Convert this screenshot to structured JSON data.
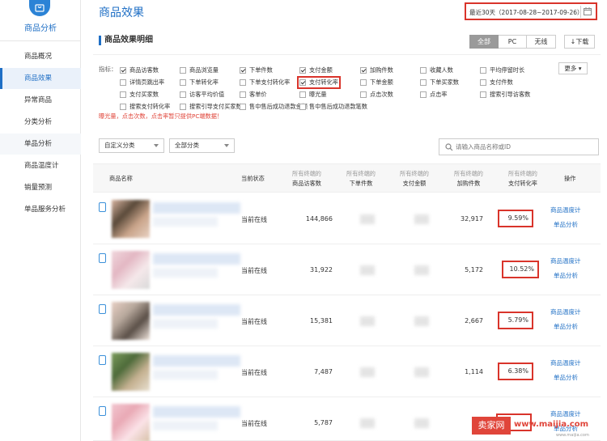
{
  "sidebar": {
    "title": "商品分析",
    "items": [
      {
        "label": "商品概况"
      },
      {
        "label": "商品效果"
      },
      {
        "label": "异常商品"
      },
      {
        "label": "分类分析"
      },
      {
        "label": "单品分析"
      },
      {
        "label": "商品温度计"
      },
      {
        "label": "销量预测"
      },
      {
        "label": "单品服务分析"
      }
    ]
  },
  "header": {
    "title": "商品效果",
    "date_range": "最近30天（2017-08-28~2017-09-26）"
  },
  "panel": {
    "title": "商品效果明细",
    "tabs": [
      {
        "label": "全部"
      },
      {
        "label": "PC"
      },
      {
        "label": "无线"
      }
    ],
    "download_label": "↓下载",
    "metrics_label": "指标：",
    "more_label": "更多",
    "metrics": [
      {
        "label": "商品访客数",
        "checked": true
      },
      {
        "label": "商品浏览量",
        "checked": false
      },
      {
        "label": "下单件数",
        "checked": true
      },
      {
        "label": "支付金额",
        "checked": true
      },
      {
        "label": "加购件数",
        "checked": true
      },
      {
        "label": "收藏人数",
        "checked": false
      },
      {
        "label": "平均停留时长",
        "checked": false
      },
      {
        "label": "详情页跳出率",
        "checked": false
      },
      {
        "label": "下单转化率",
        "checked": false
      },
      {
        "label": "下单支付转化率",
        "checked": false
      },
      {
        "label": "支付转化率",
        "checked": true
      },
      {
        "label": "下单金额",
        "checked": false
      },
      {
        "label": "下单买家数",
        "checked": false
      },
      {
        "label": "支付件数",
        "checked": false
      },
      {
        "label": "支付买家数",
        "checked": false
      },
      {
        "label": "访客平均价值",
        "checked": false
      },
      {
        "label": "客单价",
        "checked": false
      },
      {
        "label": "曝光量",
        "checked": false
      },
      {
        "label": "点击次数",
        "checked": false
      },
      {
        "label": "点击率",
        "checked": false
      },
      {
        "label": "搜索引导访客数",
        "checked": false
      },
      {
        "label": "搜索支付转化率",
        "checked": false
      },
      {
        "label": "搜索引导支付买家数",
        "checked": false
      },
      {
        "label": "售中售后成功退款金额",
        "checked": false
      },
      {
        "label": "售中售后成功退款笔数",
        "checked": false
      }
    ],
    "note": "曝光量，点击次数，点击率暂只提供PC端数据！"
  },
  "filters": {
    "category1": "自定义分类",
    "category2": "全部分类",
    "search_placeholder": "请输入商品名称或ID"
  },
  "table": {
    "headers": {
      "name": "商品名称",
      "status": "当前状态",
      "visitors_sub": "所有终端的",
      "visitors": "商品访客数",
      "orders_sub": "所有终端的",
      "orders": "下单件数",
      "pay_sub": "所有终端的",
      "pay": "支付金额",
      "cart_sub": "所有终端的",
      "cart": "加购件数",
      "conv_sub": "所有终端的",
      "conv": "支付转化率",
      "ops": "操作"
    },
    "rows": [
      {
        "status": "当前在线",
        "visitors": "144,866",
        "cart": "32,917",
        "conv": "9.59%",
        "link1": "商品温度计",
        "link2": "单品分析"
      },
      {
        "status": "当前在线",
        "visitors": "31,922",
        "cart": "5,172",
        "conv": "10.52%",
        "link1": "商品温度计",
        "link2": "单品分析"
      },
      {
        "status": "当前在线",
        "visitors": "15,381",
        "cart": "2,667",
        "conv": "5.79%",
        "link1": "商品温度计",
        "link2": "单品分析"
      },
      {
        "status": "当前在线",
        "visitors": "7,487",
        "cart": "1,114",
        "conv": "6.38%",
        "link1": "商品温度计",
        "link2": "单品分析"
      },
      {
        "status": "当前在线",
        "visitors": "5,787",
        "cart": "1,",
        "conv": "",
        "link1": "商品温度计",
        "link2": "单品分析"
      }
    ]
  },
  "watermark": {
    "logo": "卖家网",
    "url": "www.maijia.com",
    "sub": "www.maijia.com"
  },
  "colors": {
    "accent": "#1f6fc5",
    "highlight_red": "#d9342b"
  }
}
